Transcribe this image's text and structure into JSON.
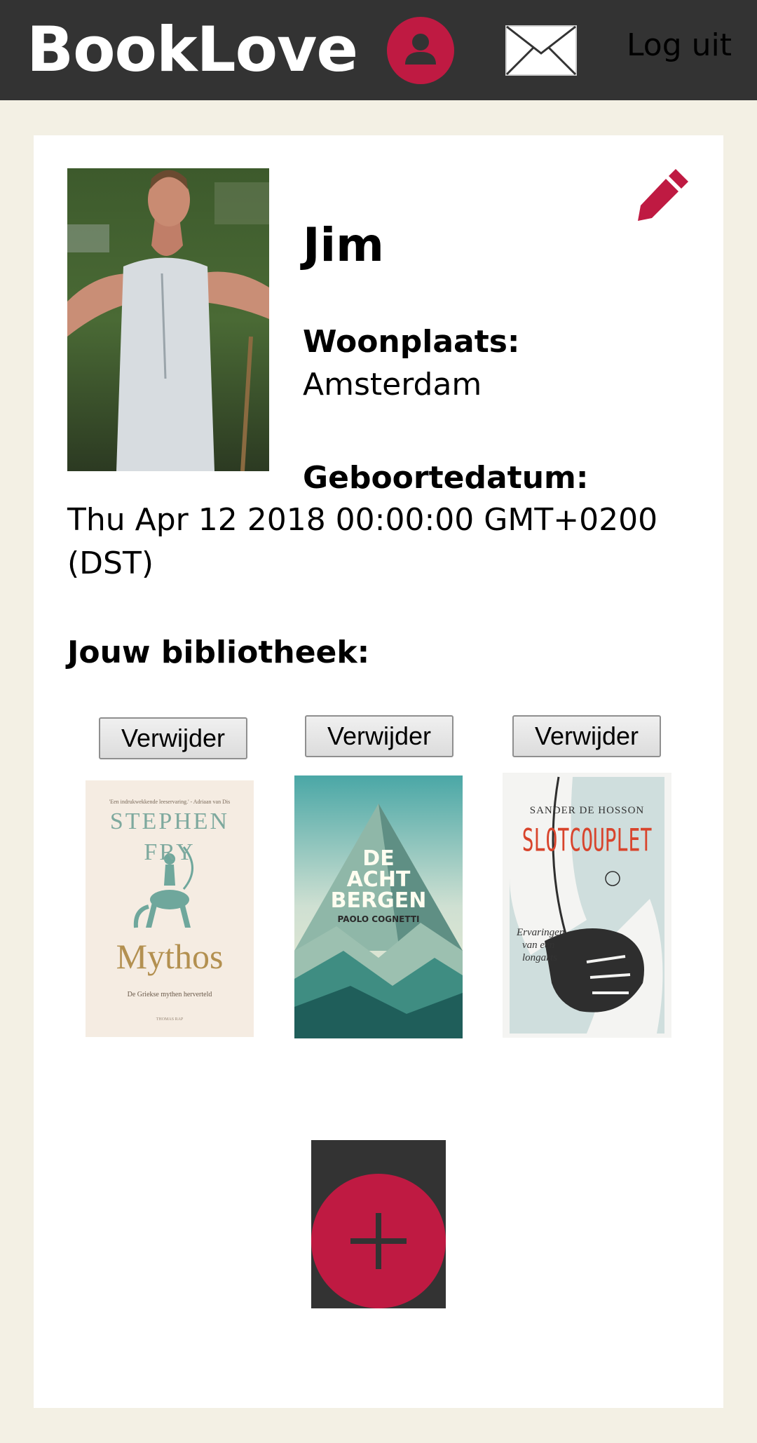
{
  "header": {
    "logo": "BookLove",
    "logout_label": "Log uit",
    "icons": [
      "user-icon",
      "mail-icon"
    ]
  },
  "profile": {
    "name": "Jim",
    "residence_label": "Woonplaats:",
    "residence": "Amsterdam",
    "birthdate_label": "Geboortedatum:",
    "birthdate": "Thu Apr 12 2018 00:00:00 GMT+0200 (DST)",
    "library_label": "Jouw bibliotheek:"
  },
  "library": {
    "remove_label": "Verwijder",
    "books": [
      {
        "author": "STEPHEN FRY",
        "author_line1": "STEPHEN",
        "author_line2": "FRY",
        "title": "Mythos",
        "subtitle": "De Griekse mythen herverteld",
        "quote": "'Een indrukwekkende leeservaring.' - Adriaan van Dis",
        "publisher": "THOMAS RAP"
      },
      {
        "title_line1": "DE",
        "title_line2": "ACHT",
        "title_line3": "BERGEN",
        "author": "PAOLO COGNETTI"
      },
      {
        "author": "SANDER DE HOSSON",
        "title": "SLOTCOUPLET",
        "subtitle_line1": "Ervaringen",
        "subtitle_line2": "van een",
        "subtitle_line3": "longarts"
      }
    ]
  },
  "colors": {
    "accent": "#bf1a42",
    "header_bg": "#333333",
    "page_bg": "#f3f0e4"
  }
}
